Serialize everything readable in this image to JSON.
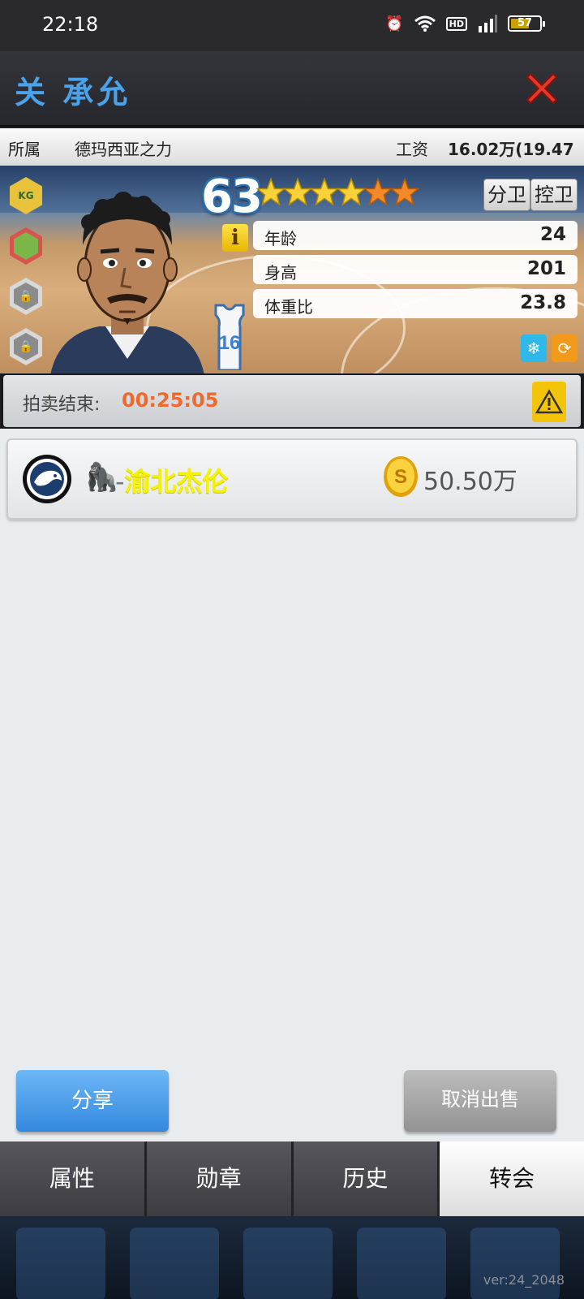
{
  "status_bar": {
    "time": "22:18",
    "network": "4G",
    "hd_label": "HD",
    "battery_level": "57"
  },
  "title": {
    "player_name": "关 承允"
  },
  "team_row": {
    "team_label": "所属",
    "team_name": "德玛西亚之力",
    "salary_label": "工资",
    "salary_value": "16.02万(19.47万)"
  },
  "player_card": {
    "rating": "63",
    "stars": {
      "full": 4,
      "orange": 2,
      "total": 6
    },
    "badges": [
      "KG",
      "boot",
      "lock",
      "lock"
    ],
    "positions": [
      "分卫",
      "控卫"
    ],
    "info_icon": "i",
    "stats": [
      {
        "label": "年龄",
        "value": "24"
      },
      {
        "label": "身高",
        "value": "201"
      },
      {
        "label": "体重比",
        "value": "23.8"
      }
    ],
    "jersey_number": "16"
  },
  "auction": {
    "label": "拍卖结束:",
    "timer": "00:25:05"
  },
  "bid": {
    "separator": "-",
    "bidder_name": "渝北杰伦",
    "amount": "50.50万"
  },
  "actions": {
    "share": "分享",
    "cancel_sale": "取消出售"
  },
  "tabs": [
    {
      "label": "属性",
      "active": false
    },
    {
      "label": "勋章",
      "active": false
    },
    {
      "label": "历史",
      "active": false
    },
    {
      "label": "转会",
      "active": true
    }
  ],
  "footer": {
    "version": "ver:24_2048"
  },
  "colors": {
    "title": "#4aa3ea",
    "timer": "#ee6a2c",
    "bidder": "#f5f20a",
    "share": "#3388dd"
  }
}
